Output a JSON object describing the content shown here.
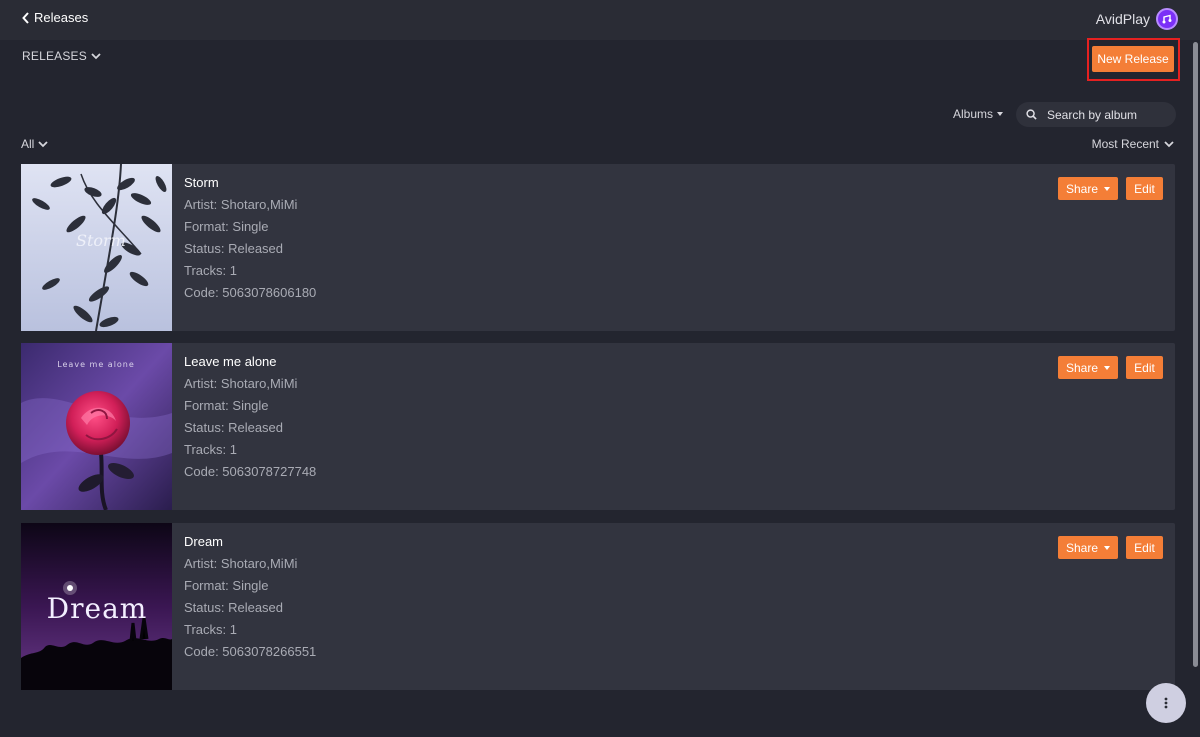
{
  "header": {
    "back_label": "Releases",
    "brand_name": "AvidPlay"
  },
  "toolbar": {
    "section_label": "RELEASES",
    "new_release_label": "New Release",
    "albums_label": "Albums",
    "search_placeholder": "Search by album",
    "filter_label": "All",
    "sort_label": "Most Recent"
  },
  "releases": [
    {
      "title": "Storm",
      "artist": "Artist: Shotaro,MiMi",
      "format": "Format: Single",
      "status": "Status: Released",
      "tracks": "Tracks: 1",
      "code": "Code: 5063078606180",
      "cover_text": "Storm",
      "share_label": "Share",
      "edit_label": "Edit"
    },
    {
      "title": "Leave me alone",
      "artist": "Artist: Shotaro,MiMi",
      "format": "Format: Single",
      "status": "Status: Released",
      "tracks": "Tracks: 1",
      "code": "Code: 5063078727748",
      "cover_text": "Leave me alone",
      "share_label": "Share",
      "edit_label": "Edit"
    },
    {
      "title": "Dream",
      "artist": "Artist: Shotaro,MiMi",
      "format": "Format: Single",
      "status": "Status: Released",
      "tracks": "Tracks: 1",
      "code": "Code: 5063078266551",
      "cover_text": "Dream",
      "share_label": "Share",
      "edit_label": "Edit"
    }
  ],
  "colors": {
    "accent": "#f47e37",
    "background": "#23252f",
    "card": "#32343f",
    "highlight_frame": "#e52121",
    "brand_purple": "#7b2ff7"
  },
  "icons": {
    "back": "chevron-left-icon",
    "brand": "avidplay-logo-icon",
    "dropdown": "chevron-down-icon",
    "search": "search-icon",
    "menu": "more-vertical-icon"
  }
}
